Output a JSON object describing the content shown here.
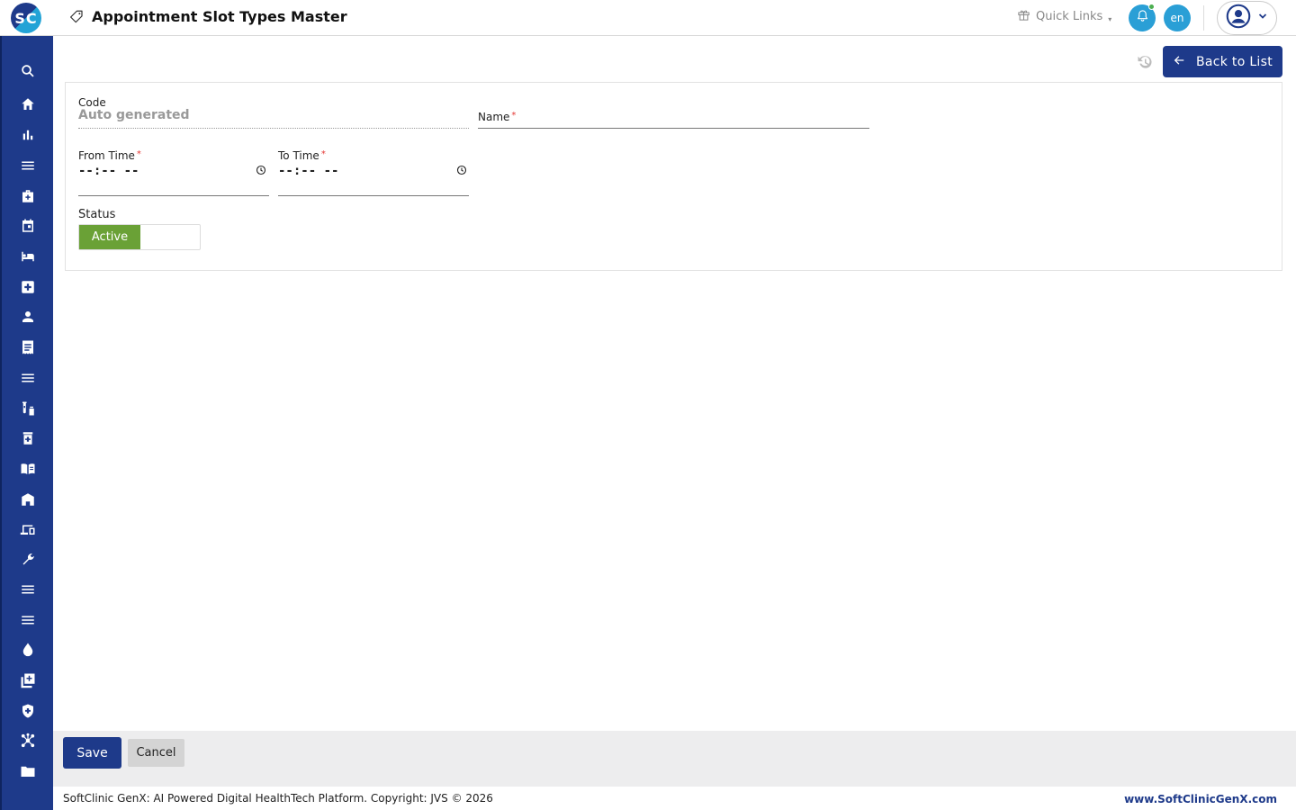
{
  "app": {
    "logo_text": "SC",
    "page_title": "Appointment Slot Types Master"
  },
  "topbar": {
    "quick_links_label": "Quick Links",
    "language": "en"
  },
  "sidebar": {
    "items": [
      {
        "icon": "search-icon"
      },
      {
        "icon": "home-icon"
      },
      {
        "icon": "bar-chart-icon"
      },
      {
        "icon": "menu-icon"
      },
      {
        "icon": "medical-bag-icon"
      },
      {
        "icon": "calendar-icon"
      },
      {
        "icon": "bed-icon"
      },
      {
        "icon": "medical-cross-icon"
      },
      {
        "icon": "person-icon"
      },
      {
        "icon": "receipt-icon"
      },
      {
        "icon": "menu-icon"
      },
      {
        "icon": "lab-vials-icon"
      },
      {
        "icon": "pharmacy-icon"
      },
      {
        "icon": "book-icon"
      },
      {
        "icon": "store-icon"
      },
      {
        "icon": "devices-icon"
      },
      {
        "icon": "wrench-icon"
      },
      {
        "icon": "menu-icon"
      },
      {
        "icon": "menu-icon"
      },
      {
        "icon": "blood-drop-icon"
      },
      {
        "icon": "add-box-icon"
      },
      {
        "icon": "shield-icon"
      },
      {
        "icon": "network-icon"
      },
      {
        "icon": "folder-icon"
      }
    ]
  },
  "toolbar": {
    "back_label": "Back to List"
  },
  "form": {
    "code_label": "Code",
    "code_value": "Auto generated",
    "name_label": "Name",
    "name_value": "",
    "from_time_label": "From Time",
    "from_time_value": "--:-- --",
    "to_time_label": "To Time",
    "to_time_value": "--:-- --",
    "status_label": "Status",
    "status_value": "Active",
    "required_marker": "*"
  },
  "actions": {
    "save_label": "Save",
    "cancel_label": "Cancel"
  },
  "footer": {
    "copyright": "SoftClinic GenX: AI Powered Digital HealthTech Platform. Copyright: JVS © 2026",
    "website": "www.SoftClinicGenX.com"
  },
  "colors": {
    "primary": "#1e3a8a",
    "accent": "#2a9fd6",
    "active_green": "#6aa136",
    "required_red": "#e53935"
  }
}
